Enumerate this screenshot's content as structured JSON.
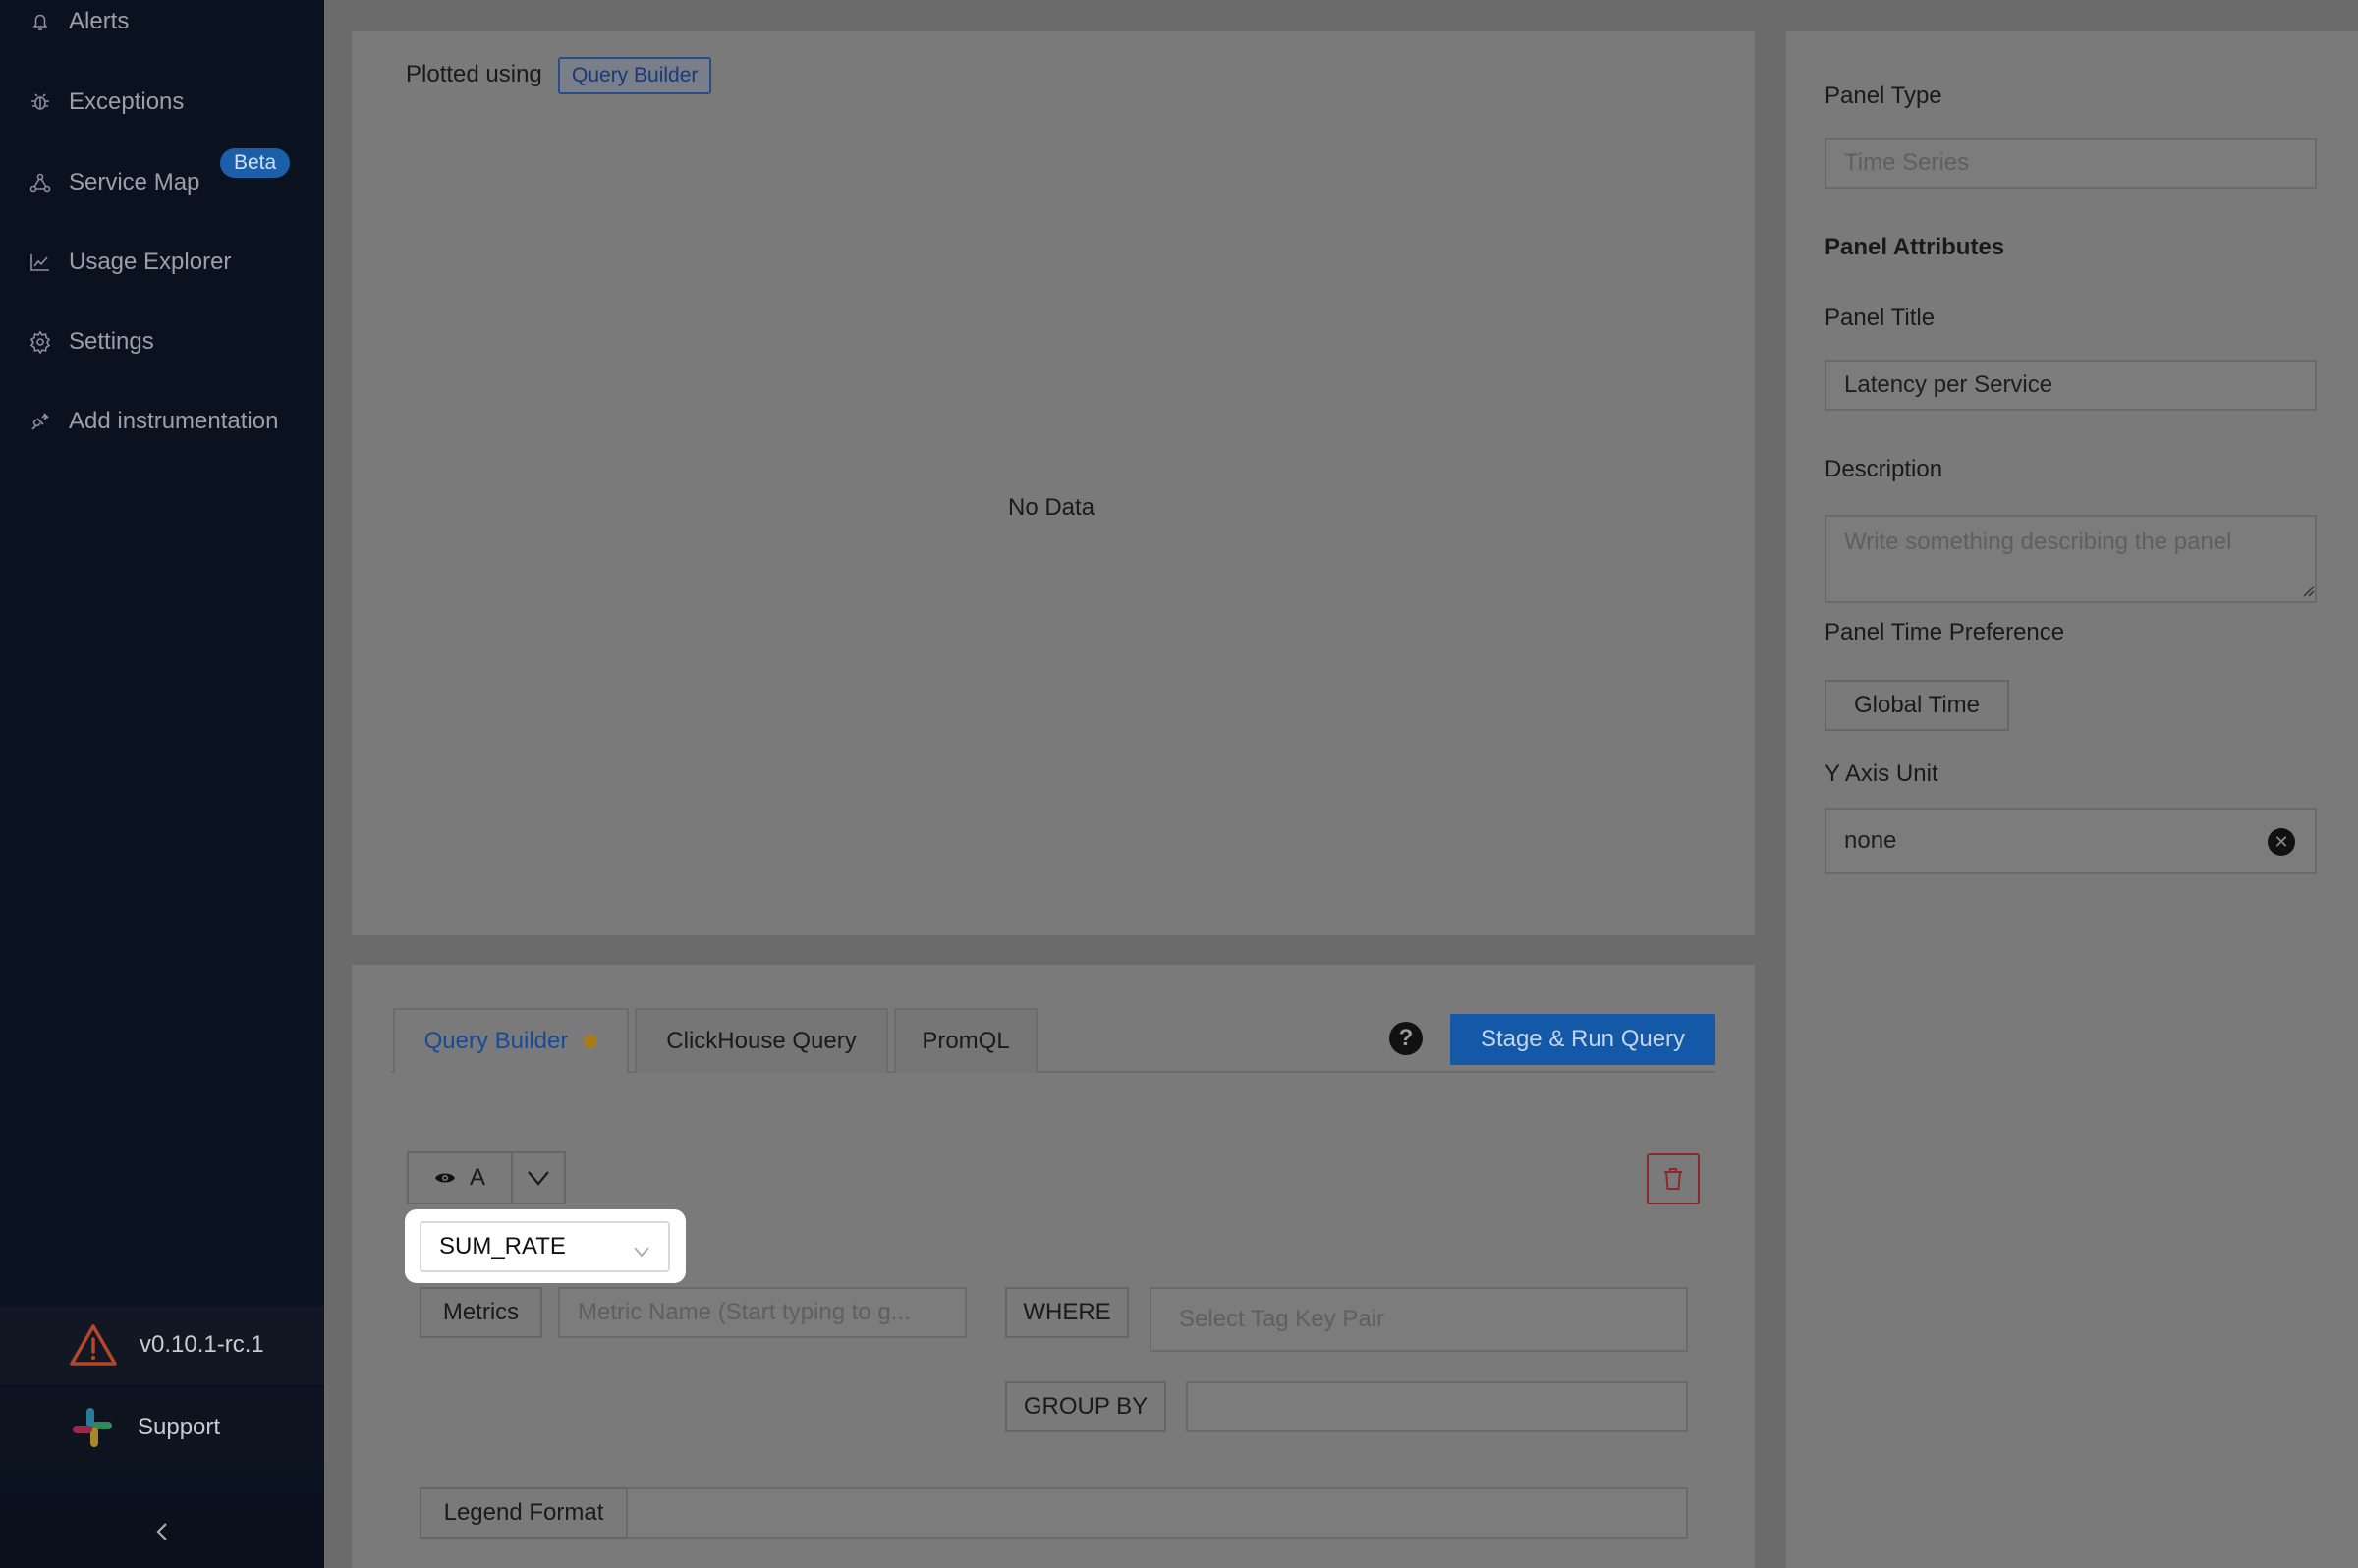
{
  "sidebar": {
    "items": [
      {
        "label": "Alerts",
        "icon": "bell-icon"
      },
      {
        "label": "Exceptions",
        "icon": "bug-icon"
      },
      {
        "label": "Service Map",
        "icon": "network-icon"
      },
      {
        "label": "Usage Explorer",
        "icon": "line-chart-icon"
      },
      {
        "label": "Settings",
        "icon": "gear-icon"
      },
      {
        "label": "Add instrumentation",
        "icon": "plug-icon"
      }
    ],
    "beta_badge": "Beta",
    "version": "v0.10.1-rc.1",
    "support": "Support"
  },
  "chart": {
    "plotted_using": "Plotted using",
    "plotted_tag": "Query Builder",
    "empty_text": "No Data"
  },
  "query": {
    "tabs": [
      {
        "label": "Query Builder",
        "active": true
      },
      {
        "label": "ClickHouse Query",
        "active": false
      },
      {
        "label": "PromQL",
        "active": false
      }
    ],
    "help": "?",
    "run_button": "Stage & Run Query",
    "query_name": "A",
    "aggregate": "SUM_RATE",
    "metrics_label": "Metrics",
    "metric_placeholder": "Metric Name (Start typing to g...",
    "where_label": "WHERE",
    "tag_placeholder": "Select Tag Key Pair",
    "group_by_label": "GROUP BY",
    "legend_label": "Legend Format"
  },
  "right": {
    "panel_type_label": "Panel Type",
    "panel_type_value": "Time Series",
    "attributes_heading": "Panel Attributes",
    "title_label": "Panel Title",
    "title_value": "Latency per Service",
    "description_label": "Description",
    "description_placeholder": "Write something describing the  panel",
    "time_pref_label": "Panel Time Preference",
    "time_pref_value": "Global Time",
    "y_axis_label": "Y Axis Unit",
    "y_axis_value": "none"
  },
  "colors": {
    "overlay": "#6b6b6b",
    "sidebar": "#0a111f",
    "accent": "#1458a8"
  }
}
